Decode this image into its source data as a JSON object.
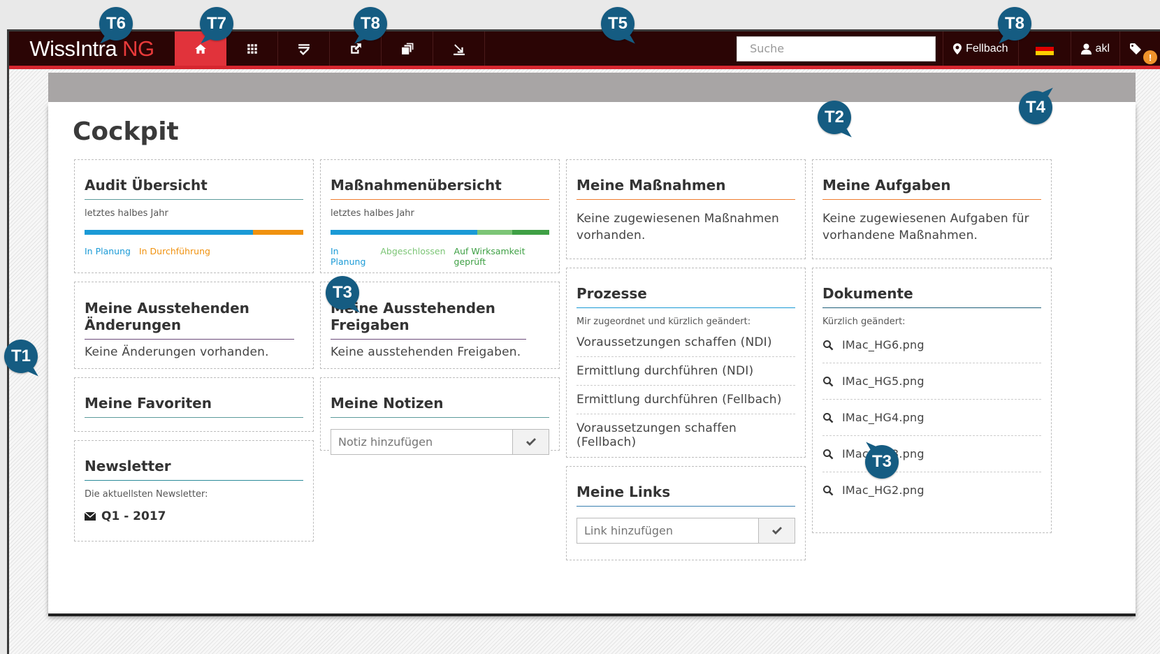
{
  "app": {
    "logo_main": "WissIntra",
    "logo_suffix": "NG",
    "search_placeholder": "Suche",
    "location": "Fellbach",
    "user": "akl",
    "alert_badge": "!"
  },
  "nav": [
    {
      "name": "home",
      "icon": "home-icon",
      "active": true
    },
    {
      "name": "apps",
      "icon": "grid-icon",
      "active": false
    },
    {
      "name": "tasks",
      "icon": "checklist-icon",
      "active": false
    },
    {
      "name": "edit",
      "icon": "external-edit-icon",
      "active": false
    },
    {
      "name": "documents",
      "icon": "stack-icon",
      "active": false
    },
    {
      "name": "download",
      "icon": "download-icon",
      "active": false
    }
  ],
  "page": {
    "title": "Cockpit"
  },
  "cards": {
    "audit": {
      "title": "Audit Übersicht",
      "subtitle": "letztes halbes Jahr",
      "progress": [
        {
          "label": "In Planung",
          "fraction": 0.77,
          "color": "#1a9ad6"
        },
        {
          "label": "In Durchführung",
          "fraction": 0.23,
          "color": "#f0920f"
        }
      ]
    },
    "massnahmen_overview": {
      "title": "Maßnahmenübersicht",
      "subtitle": "letztes halbes Jahr",
      "progress": [
        {
          "label": "In Planung",
          "fraction": 0.67,
          "color": "#1a9ad6"
        },
        {
          "label": "Abgeschlossen",
          "fraction": 0.16,
          "color": "#7cc576"
        },
        {
          "label": "Auf Wirksamkeit geprüft",
          "fraction": 0.17,
          "color": "#3fa045"
        }
      ]
    },
    "meine_massnahmen": {
      "title": "Meine Maßnahmen",
      "text": "Keine zugewiesenen Maßnahmen vorhanden."
    },
    "meine_aufgaben": {
      "title": "Meine Aufgaben",
      "text": "Keine zugewiesenen Aufgaben für vorhandene Maßnahmen."
    },
    "aenderungen": {
      "title": "Meine Ausstehenden Änderungen",
      "text": "Keine Änderungen vorhanden."
    },
    "freigaben": {
      "title": "Meine Ausstehenden Freigaben",
      "text": "Keine ausstehenden Freigaben."
    },
    "prozesse": {
      "title": "Prozesse",
      "subtitle": "Mir zugeordnet und kürzlich geändert:",
      "items": [
        "Voraussetzungen schaffen (NDI)",
        "Ermittlung durchführen (NDI)",
        "Ermittlung durchführen (Fellbach)",
        "Voraussetzungen schaffen (Fellbach)"
      ]
    },
    "dokumente": {
      "title": "Dokumente",
      "subtitle": "Kürzlich geändert:",
      "items": [
        "IMac_HG6.png",
        "IMac_HG5.png",
        "IMac_HG4.png",
        "IMac_HG3.png",
        "IMac_HG2.png"
      ]
    },
    "favoriten": {
      "title": "Meine Favoriten"
    },
    "notizen": {
      "title": "Meine Notizen",
      "placeholder": "Notiz hinzufügen"
    },
    "links": {
      "title": "Meine Links",
      "placeholder": "Link hinzufügen"
    },
    "newsletter": {
      "title": "Newsletter",
      "subtitle": "Die aktuellsten Newsletter:",
      "item": "Q1 - 2017"
    }
  },
  "markers": [
    "T1",
    "T2",
    "T3",
    "T3",
    "T4",
    "T5",
    "T6",
    "T7",
    "T8",
    "T8"
  ],
  "colors": {
    "topbar": "#2b0505",
    "accent_red": "#e1333b",
    "marker_blue": "#155c82"
  }
}
